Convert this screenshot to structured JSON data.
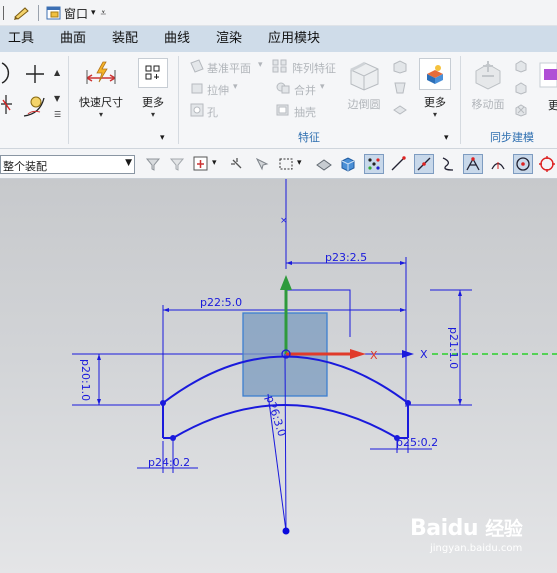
{
  "quick_access": {
    "window_label": "窗口"
  },
  "menubar": {
    "items": [
      "工具",
      "曲面",
      "装配",
      "曲线",
      "渲染",
      "应用模块"
    ]
  },
  "ribbon": {
    "quick_dim_label": "快速尺寸",
    "more_label_1": "更多",
    "datum_plane_label": "基准平面",
    "pattern_feature_label": "阵列特征",
    "extrude_label": "拉伸",
    "unite_label": "合并",
    "hole_label": "孔",
    "shell_label": "抽壳",
    "edge_blend_label": "边倒圆",
    "more_label_2": "更多",
    "feature_group": "特征",
    "move_face_label": "移动面",
    "sync_group": "同步建模",
    "more_label_3": "更"
  },
  "selection_bar": {
    "scope_value": "整个装配"
  },
  "canvas": {
    "dims": {
      "p23": "p23:2.5",
      "p22": "p22:5.0",
      "p21": "p21:1.0",
      "p20": "p20:1.0",
      "p26": "p26:3.0",
      "p24": "p24:0.2",
      "p25": "p25:0.2"
    },
    "axis_x_label": "X",
    "axis_x2_label": "X"
  },
  "watermark": {
    "brand": "Baidu",
    "jingyan": "经验",
    "url": "jingyan.baidu.com"
  },
  "colors": {
    "menubar": "#cfdce9",
    "sketch": "#1a1adc",
    "x_axis": "#e03a2a",
    "y_axis": "#2e9a3c",
    "green_dash": "#2bd02b"
  }
}
